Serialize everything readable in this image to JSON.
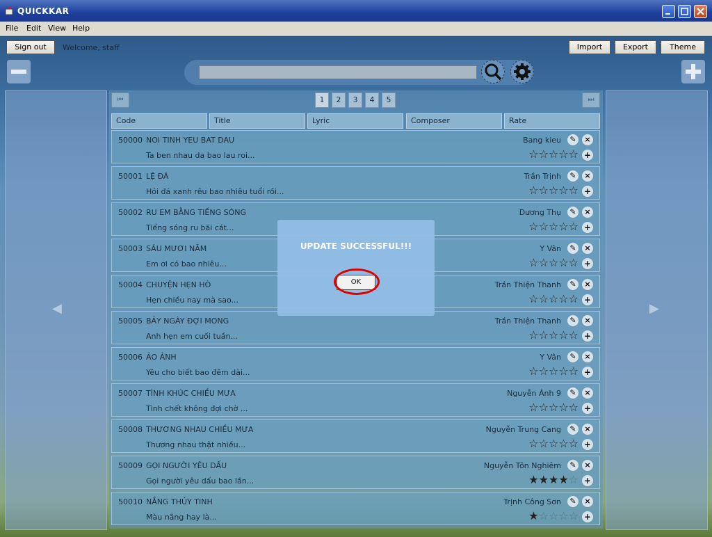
{
  "window": {
    "title": "QUICKKAR"
  },
  "menu": [
    "File",
    "Edit",
    "View",
    "Help"
  ],
  "toolbar": {
    "sign_out": "Sign out",
    "welcome": "Welcome, staff",
    "import": "Import",
    "export": "Export",
    "theme": "Theme"
  },
  "pagination": {
    "pages": [
      "1",
      "2",
      "3",
      "4",
      "5"
    ],
    "current": "1",
    "first_icon": "first-page-icon",
    "last_icon": "last-page-icon"
  },
  "columns": [
    "Code",
    "Title",
    "Lyric",
    "Composer",
    "Rate"
  ],
  "songs": [
    {
      "code": "50000",
      "title": "NOI TINH YEU BAT DAU",
      "lyric": "Ta ben nhau da bao lau roi...",
      "composer": "Bang kieu",
      "rating": 0
    },
    {
      "code": "50001",
      "title": "LỆ ĐÁ",
      "lyric": "Hỏi đá xanh rêu bao nhiêu tuổi rồi...",
      "composer": "Trần Trịnh",
      "rating": 0
    },
    {
      "code": "50002",
      "title": "RU EM BẰNG TIẾNG SÓNG",
      "lyric": "Tiếng sóng ru bãi cát...",
      "composer": "Dương Thụ",
      "rating": 0
    },
    {
      "code": "50003",
      "title": "SÁU MƯƠI NĂM",
      "lyric": "Em ơi có bao nhiêu...",
      "composer": "Y Vân",
      "rating": 0
    },
    {
      "code": "50004",
      "title": "CHUYỆN HẸN HÒ",
      "lyric": "Hẹn chiều nay mà sao...",
      "composer": "Trần Thiện Thanh",
      "rating": 0
    },
    {
      "code": "50005",
      "title": "BẢY NGÀY ĐỢI MONG",
      "lyric": "Anh hẹn em cuối tuần...",
      "composer": "Trần Thiện Thanh",
      "rating": 0
    },
    {
      "code": "50006",
      "title": "ẢO ẢNH",
      "lyric": "Yêu cho biết bao đêm dài...",
      "composer": "Y Vân",
      "rating": 0
    },
    {
      "code": "50007",
      "title": "TÌNH KHÚC CHIỀU MƯA",
      "lyric": "Tình chết không đợi chờ ...",
      "composer": "Nguyễn Ánh 9",
      "rating": 0
    },
    {
      "code": "50008",
      "title": "THƯƠNG NHAU CHIỀU MƯA",
      "lyric": "Thương nhau thật nhiều...",
      "composer": "Nguyễn Trung Cang",
      "rating": 0
    },
    {
      "code": "50009",
      "title": "GỌI NGƯỜI YÊU DẤU",
      "lyric": "Gọi người yêu dấu bao lần...",
      "composer": "Nguyễn Tôn Nghiêm",
      "rating": 4
    },
    {
      "code": "50010",
      "title": "NẮNG THỦY TINH",
      "lyric": "Màu nắng hay là...",
      "composer": "Trịnh Công Sơn",
      "rating": 1
    }
  ],
  "dialog": {
    "message": "UPDATE SUCCESSFUL!!!",
    "ok": "OK"
  },
  "colors": {
    "highlight_ring": "#e00000",
    "title_bar": "#1d3f9b"
  }
}
